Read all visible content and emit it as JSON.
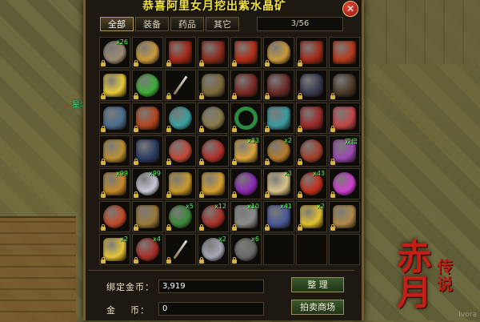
{
  "scene": {
    "npc_label": "星城",
    "logo_main": "赤月",
    "logo_sub": "传说",
    "watermark": "Ivora"
  },
  "inventory": {
    "notice": "恭喜阿里女月挖出紫水晶矿",
    "close_icon": "close-icon",
    "tabs": [
      {
        "label": "全部",
        "active": true
      },
      {
        "label": "装备",
        "active": false
      },
      {
        "label": "药品",
        "active": false
      },
      {
        "label": "其它",
        "active": false
      }
    ],
    "page": "3/56",
    "slots": [
      {
        "icon": "ore-stone-icon",
        "color": "#9a8a72",
        "shape": "round",
        "qty": "x26"
      },
      {
        "icon": "gourd-icon",
        "color": "#c99a3c",
        "shape": "gourd",
        "qty": ""
      },
      {
        "icon": "potion-bottles-icon",
        "color": "#a22616",
        "shape": "bottle",
        "qty": ""
      },
      {
        "icon": "potion-bottles-icon",
        "color": "#8a2a1c",
        "shape": "bottle",
        "qty": ""
      },
      {
        "icon": "potion-bottles-icon",
        "color": "#b12c18",
        "shape": "bottle",
        "qty": ""
      },
      {
        "icon": "gourd-icon",
        "color": "#c99a3c",
        "shape": "gourd",
        "qty": ""
      },
      {
        "icon": "potion-bottles-icon",
        "color": "#a02a18",
        "shape": "bottle",
        "qty": ""
      },
      {
        "icon": "potion-bottles-icon",
        "color": "#b33a1e",
        "shape": "bottle",
        "qty": ""
      },
      {
        "icon": "yellow-gem-icon",
        "color": "#e6c93a",
        "shape": "",
        "qty": ""
      },
      {
        "icon": "jade-orb-icon",
        "color": "#3fae3a",
        "shape": "round",
        "qty": ""
      },
      {
        "icon": "trident-icon",
        "color": "",
        "shape": "weapon",
        "qty": ""
      },
      {
        "icon": "armor-icon",
        "color": "#7a6a3a",
        "shape": "armor",
        "qty": ""
      },
      {
        "icon": "armor-icon",
        "color": "#7a2a22",
        "shape": "armor",
        "qty": ""
      },
      {
        "icon": "armor-icon",
        "color": "#6a2a2a",
        "shape": "armor",
        "qty": ""
      },
      {
        "icon": "armor-icon",
        "color": "#3a3a52",
        "shape": "armor",
        "qty": ""
      },
      {
        "icon": "armor-icon",
        "color": "#4a3a28",
        "shape": "armor",
        "qty": ""
      },
      {
        "icon": "helmet-icon",
        "color": "#4a6e8e",
        "shape": "armor",
        "qty": ""
      },
      {
        "icon": "helmet-icon",
        "color": "#b2461e",
        "shape": "armor",
        "qty": ""
      },
      {
        "icon": "necklace-icon",
        "color": "#3aa0a0",
        "shape": "round",
        "qty": ""
      },
      {
        "icon": "necklace-icon",
        "color": "#8a7a4a",
        "shape": "round",
        "qty": ""
      },
      {
        "icon": "ring-icon",
        "color": "",
        "shape": "ring",
        "qty": ""
      },
      {
        "icon": "gauntlet-icon",
        "color": "#3a9aa0",
        "shape": "",
        "qty": ""
      },
      {
        "icon": "boots-icon",
        "color": "#9a2a28",
        "shape": "",
        "qty": ""
      },
      {
        "icon": "boots-icon",
        "color": "#c2484a",
        "shape": "",
        "qty": ""
      },
      {
        "icon": "helmet-icon",
        "color": "#b89033",
        "shape": "armor",
        "qty": ""
      },
      {
        "icon": "belt-icon",
        "color": "#2c3c66",
        "shape": "",
        "qty": ""
      },
      {
        "icon": "pouch-icon",
        "color": "#c2483a",
        "shape": "round",
        "qty": ""
      },
      {
        "icon": "coin-bag-icon",
        "color": "#b0302c",
        "shape": "round",
        "qty": ""
      },
      {
        "icon": "scroll-icon",
        "color": "#d9a43c",
        "shape": "",
        "qty": "x33"
      },
      {
        "icon": "bread-icon",
        "color": "#b27a2a",
        "shape": "round",
        "qty": "x2"
      },
      {
        "icon": "seed-bag-icon",
        "color": "#a2402c",
        "shape": "round",
        "qty": ""
      },
      {
        "icon": "double-exp-card-icon",
        "color": "#9a4ab0",
        "shape": "",
        "qty": "双倍"
      },
      {
        "icon": "arrowhead-icon",
        "color": "#c28a2a",
        "shape": "",
        "qty": "x99"
      },
      {
        "icon": "silver-ore-icon",
        "color": "#c8c8d8",
        "shape": "round",
        "qty": "x99"
      },
      {
        "icon": "gold-scroll-icon",
        "color": "#c89a2c",
        "shape": "",
        "qty": ""
      },
      {
        "icon": "gold-scroll-icon",
        "color": "#d4a030",
        "shape": "",
        "qty": ""
      },
      {
        "icon": "purple-orb-icon",
        "color": "#8a2ab2",
        "shape": "round",
        "qty": ""
      },
      {
        "icon": "knife-icon",
        "color": "#d8c48a",
        "shape": "",
        "qty": "x3"
      },
      {
        "icon": "red-gem-icon",
        "color": "#c2301c",
        "shape": "round",
        "qty": "x43"
      },
      {
        "icon": "magic-orb-icon",
        "color": "#d040d0",
        "shape": "round",
        "qty": ""
      },
      {
        "icon": "exp-orb-icon",
        "color": "#c24a2a",
        "shape": "round",
        "qty": ""
      },
      {
        "icon": "treasure-chest-icon",
        "color": "#9a7a3a",
        "shape": "",
        "qty": ""
      },
      {
        "icon": "green-herb-icon",
        "color": "#3a8a3a",
        "shape": "round",
        "qty": "x5"
      },
      {
        "icon": "coin-bag-icon",
        "color": "#a83028",
        "shape": "round",
        "qty": "x12"
      },
      {
        "icon": "pickaxe-icon",
        "color": "#8a8a8a",
        "shape": "",
        "qty": "x10"
      },
      {
        "icon": "gauntlet-icon",
        "color": "#4a5a9a",
        "shape": "",
        "qty": "x41"
      },
      {
        "icon": "gold-ticket-icon",
        "color": "#e0c030",
        "shape": "",
        "qty": "x2"
      },
      {
        "icon": "claw-icon",
        "color": "#b08a4a",
        "shape": "",
        "qty": ""
      },
      {
        "icon": "gold-ticket-icon",
        "color": "#e6c43a",
        "shape": "",
        "qty": "x2"
      },
      {
        "icon": "meat-icon",
        "color": "#a8302a",
        "shape": "round",
        "qty": "x4"
      },
      {
        "icon": "trident-icon",
        "color": "",
        "shape": "weapon",
        "qty": ""
      },
      {
        "icon": "silver-ore-icon",
        "color": "#a8a8b8",
        "shape": "round",
        "qty": "x2"
      },
      {
        "icon": "iron-ore-icon",
        "color": "#6a6a6a",
        "shape": "round",
        "qty": "x6"
      },
      {
        "icon": "",
        "color": "",
        "shape": "empty",
        "qty": ""
      },
      {
        "icon": "",
        "color": "",
        "shape": "empty",
        "qty": ""
      },
      {
        "icon": "",
        "color": "",
        "shape": "empty",
        "qty": ""
      }
    ],
    "locked_slots": [
      0,
      1,
      2,
      3,
      4,
      5,
      6,
      8,
      9,
      10,
      11,
      12,
      13,
      14,
      15,
      16,
      17,
      18,
      19,
      20,
      21,
      22,
      23,
      24,
      25,
      26,
      27,
      28,
      29,
      30,
      31,
      32,
      33,
      34,
      35,
      36,
      37,
      38,
      39,
      40,
      41,
      42,
      43,
      44,
      45,
      46,
      47,
      48,
      49,
      50,
      51,
      52
    ],
    "bound_gold_label": "绑定金币：",
    "bound_gold_value": "3,919",
    "gold_label": "金    币：",
    "gold_value": "0",
    "sort_button": "整 理",
    "auction_button": "拍卖商场"
  }
}
